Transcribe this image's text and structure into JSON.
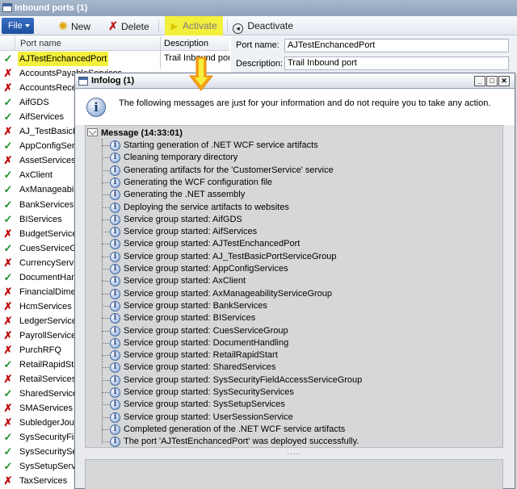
{
  "window": {
    "title": "Inbound ports (1)"
  },
  "toolbar": {
    "file_label": "File",
    "new_label": "New",
    "delete_label": "Delete",
    "activate_label": "Activate",
    "deactivate_label": "Deactivate"
  },
  "grid": {
    "header_name": "Port name",
    "rows": [
      {
        "status": "ok",
        "name": "AJTestEnchancedPort",
        "selected": true
      },
      {
        "status": "no",
        "name": "AccountsPayableServices"
      },
      {
        "status": "no",
        "name": "AccountsReceivableServices"
      },
      {
        "status": "ok",
        "name": "AifGDS"
      },
      {
        "status": "ok",
        "name": "AifServices"
      },
      {
        "status": "no",
        "name": "AJ_TestBasicPortServiceGroup"
      },
      {
        "status": "ok",
        "name": "AppConfigServices"
      },
      {
        "status": "no",
        "name": "AssetServices"
      },
      {
        "status": "ok",
        "name": "AxClient"
      },
      {
        "status": "ok",
        "name": "AxManageabilityServiceGroup"
      },
      {
        "status": "ok",
        "name": "BankServices"
      },
      {
        "status": "ok",
        "name": "BIServices"
      },
      {
        "status": "no",
        "name": "BudgetServices"
      },
      {
        "status": "ok",
        "name": "CuesServiceGroup"
      },
      {
        "status": "no",
        "name": "CurrencyServices"
      },
      {
        "status": "ok",
        "name": "DocumentHandling"
      },
      {
        "status": "no",
        "name": "FinancialDimensionServices"
      },
      {
        "status": "no",
        "name": "HcmServices"
      },
      {
        "status": "no",
        "name": "LedgerServices"
      },
      {
        "status": "no",
        "name": "PayrollServices"
      },
      {
        "status": "no",
        "name": "PurchRFQ"
      },
      {
        "status": "ok",
        "name": "RetailRapidStart"
      },
      {
        "status": "no",
        "name": "RetailServices"
      },
      {
        "status": "ok",
        "name": "SharedServices"
      },
      {
        "status": "no",
        "name": "SMAServices"
      },
      {
        "status": "no",
        "name": "SubledgerJournalServices"
      },
      {
        "status": "ok",
        "name": "SysSecurityFieldAccessServiceGroup"
      },
      {
        "status": "ok",
        "name": "SysSecurityServices"
      },
      {
        "status": "ok",
        "name": "SysSetupServices"
      },
      {
        "status": "no",
        "name": "TaxServices"
      }
    ]
  },
  "descr_column": {
    "header": "Description",
    "first_value": "Trail Inbound port"
  },
  "detail": {
    "port_name_label": "Port name:",
    "port_name_value": "AJTestEnchancedPort",
    "description_label": "Description:",
    "description_value": "Trail Inbound port"
  },
  "infolog": {
    "title": "Infolog (1)",
    "info_message": "The following messages are just for your information and do not require you to take any action.",
    "root": "Message (14:33:01)",
    "messages": [
      "Starting generation of .NET WCF service artifacts",
      "Cleaning temporary directory",
      "Generating artifacts for the 'CustomerService' service",
      "Generating the WCF configuration file",
      "Generating the .NET assembly",
      "Deploying the service artifacts to websites",
      "Service group started: AifGDS",
      "Service group started: AifServices",
      "Service group started: AJTestEnchancedPort",
      "Service group started: AJ_TestBasicPortServiceGroup",
      "Service group started: AppConfigServices",
      "Service group started: AxClient",
      "Service group started: AxManageabilityServiceGroup",
      "Service group started: BankServices",
      "Service group started: BIServices",
      "Service group started: CuesServiceGroup",
      "Service group started: DocumentHandling",
      "Service group started: RetailRapidStart",
      "Service group started: SharedServices",
      "Service group started: SysSecurityFieldAccessServiceGroup",
      "Service group started: SysSecurityServices",
      "Service group started: SysSetupServices",
      "Service group started: UserSessionService",
      "Completed generation of the .NET WCF service artifacts",
      "The port 'AJTestEnchancedPort' was deployed successfully."
    ],
    "minimize": "_",
    "maximize": "□",
    "close": "✕",
    "splitter": "····"
  },
  "colors": {
    "highlight": "#f3ef3c",
    "annotation_arrow": "#f7a21b",
    "ok": "#1f8f2a",
    "error": "#c00000"
  }
}
